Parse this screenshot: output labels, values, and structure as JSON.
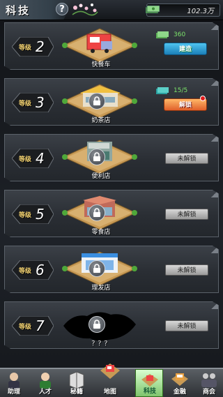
{
  "header": {
    "title": "科技",
    "help_label": "?",
    "money": "102.3万"
  },
  "rows": [
    {
      "level_label": "等级",
      "level": "2",
      "name": "快餐车",
      "locked": false,
      "action": "建造",
      "action_type": "build",
      "cost": "360",
      "has_alert": false
    },
    {
      "level_label": "等级",
      "level": "3",
      "name": "奶茶店",
      "locked": true,
      "action": "解锁",
      "action_type": "unlock",
      "cost": "15/5",
      "has_alert": true
    },
    {
      "level_label": "等级",
      "level": "4",
      "name": "便利店",
      "locked": true,
      "action": "未解锁",
      "action_type": "disabled"
    },
    {
      "level_label": "等级",
      "level": "5",
      "name": "零食店",
      "locked": true,
      "action": "未解锁",
      "action_type": "disabled"
    },
    {
      "level_label": "等级",
      "level": "6",
      "name": "理发店",
      "locked": true,
      "action": "未解锁",
      "action_type": "disabled"
    },
    {
      "level_label": "等级",
      "level": "7",
      "name": "？？？",
      "locked": true,
      "action": "未解锁",
      "action_type": "disabled"
    }
  ],
  "nav": {
    "items": [
      {
        "label": "助理",
        "icon": "assistant-icon",
        "active": false
      },
      {
        "label": "人才",
        "icon": "talent-icon",
        "active": false
      },
      {
        "label": "秘籍",
        "icon": "book-icon",
        "active": false
      },
      {
        "label": "地图",
        "icon": "map-icon",
        "active": false
      },
      {
        "label": "科技",
        "icon": "tech-icon",
        "active": true
      },
      {
        "label": "金融",
        "icon": "finance-icon",
        "active": false
      },
      {
        "label": "商会",
        "icon": "guild-icon",
        "active": false
      }
    ]
  },
  "colors": {
    "accent_green": "#7be36a",
    "build_blue": "#1b7fb8",
    "unlock_orange": "#e0602a",
    "alert_red": "#e01a1a"
  }
}
